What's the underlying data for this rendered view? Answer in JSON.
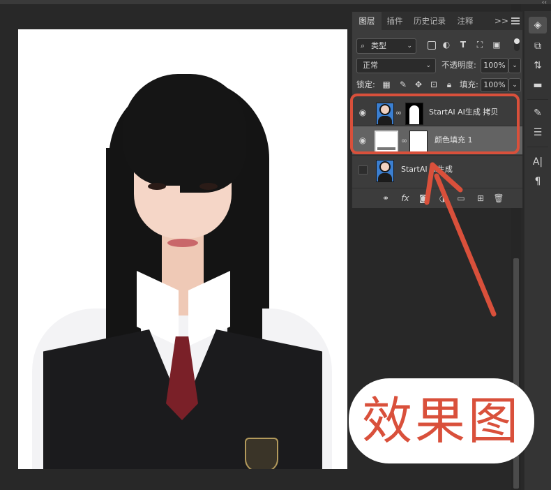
{
  "panel": {
    "tabs": [
      "图层",
      "插件",
      "历史记录",
      "注释"
    ],
    "more_icon": "double-chevron-right-icon",
    "filter": {
      "icon": "search-icon",
      "label": "类型"
    },
    "blend_mode": "正常",
    "opacity_label": "不透明度:",
    "opacity_value": "100%",
    "lock_label": "锁定:",
    "fill_label": "填充:",
    "fill_value": "100%"
  },
  "layers": [
    {
      "name": "StartAI AI生成 拷贝",
      "visible": true,
      "selected": false
    },
    {
      "name": "颜色填充 1",
      "visible": true,
      "selected": true
    },
    {
      "name": "StartAI AI生成",
      "visible": false,
      "selected": false
    }
  ],
  "annotation": {
    "caption": "效果图",
    "color": "#d9503b"
  },
  "colors": {
    "panel_bg": "#3c3c3c",
    "app_bg": "#282828",
    "selected_row": "#636363"
  }
}
